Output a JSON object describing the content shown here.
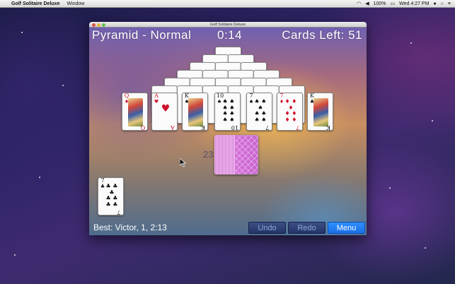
{
  "menubar": {
    "app_name": "Golf Solitaire Deluxe",
    "items": [
      "Window"
    ],
    "clock": "Wed 4:27 PM",
    "battery": "100%"
  },
  "window": {
    "title": "Golf Solitaire Deluxe"
  },
  "hud": {
    "mode": "Pyramid - Normal",
    "time": "0:14",
    "cards_left": "Cards Left: 51"
  },
  "board": {
    "tableau_front": [
      {
        "rank": "Q",
        "suit": "♦",
        "color": "red",
        "face": true
      },
      {
        "rank": "A",
        "suit": "♥",
        "color": "red",
        "face": false
      },
      {
        "rank": "K",
        "suit": "♠",
        "color": "blk",
        "face": true
      },
      {
        "rank": "10",
        "suit": "♠",
        "color": "blk",
        "face": false
      },
      {
        "rank": "7",
        "suit": "♠",
        "color": "blk",
        "face": false
      },
      {
        "rank": "7",
        "suit": "♦",
        "color": "red",
        "face": false
      },
      {
        "rank": "K",
        "suit": "♣",
        "color": "blk",
        "face": true
      }
    ],
    "stock_count": "23",
    "waste_card": {
      "rank": "7",
      "suit": "♣",
      "color": "blk"
    }
  },
  "footer": {
    "best": "Best: Victor, 1, 2:13",
    "undo_label": "Undo",
    "redo_label": "Redo",
    "menu_label": "Menu"
  },
  "colors": {
    "menu_button": "#1a6ee8",
    "action_button": "#233466",
    "stock_back": "#d27bd5"
  }
}
